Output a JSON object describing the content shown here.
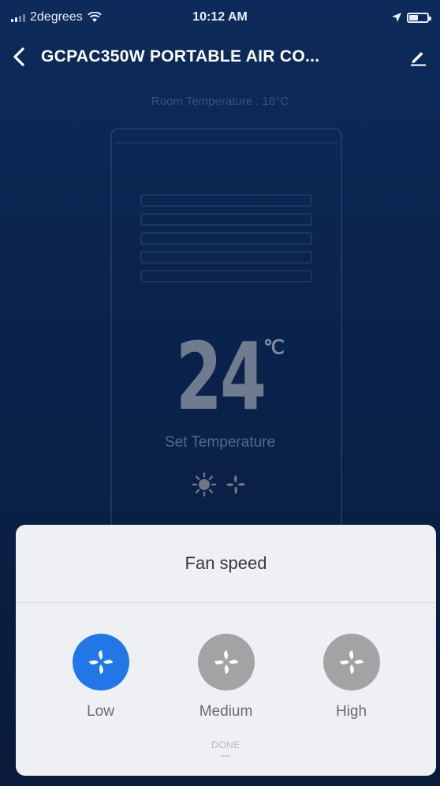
{
  "status_bar": {
    "carrier": "2degrees",
    "time": "10:12 AM"
  },
  "nav": {
    "title": "GCPAC350W PORTABLE AIR CO..."
  },
  "device": {
    "room_temperature": "Room Temperature : 18°C",
    "set_temperature_value": "24",
    "set_temperature_unit": "℃",
    "set_temperature_label": "Set Temperature"
  },
  "fan_speed_sheet": {
    "title": "Fan speed",
    "options": [
      {
        "label": "Low",
        "selected": true
      },
      {
        "label": "Medium",
        "selected": false
      },
      {
        "label": "High",
        "selected": false
      }
    ],
    "done_label": "DONE"
  },
  "colors": {
    "accent": "#2277e6",
    "inactive": "#a3a3a5",
    "background": "#0b2550"
  },
  "icons": {
    "back": "chevron-left-icon",
    "edit": "pencil-icon",
    "heat_mode": "sun-icon",
    "fan_mode": "fan-icon"
  }
}
